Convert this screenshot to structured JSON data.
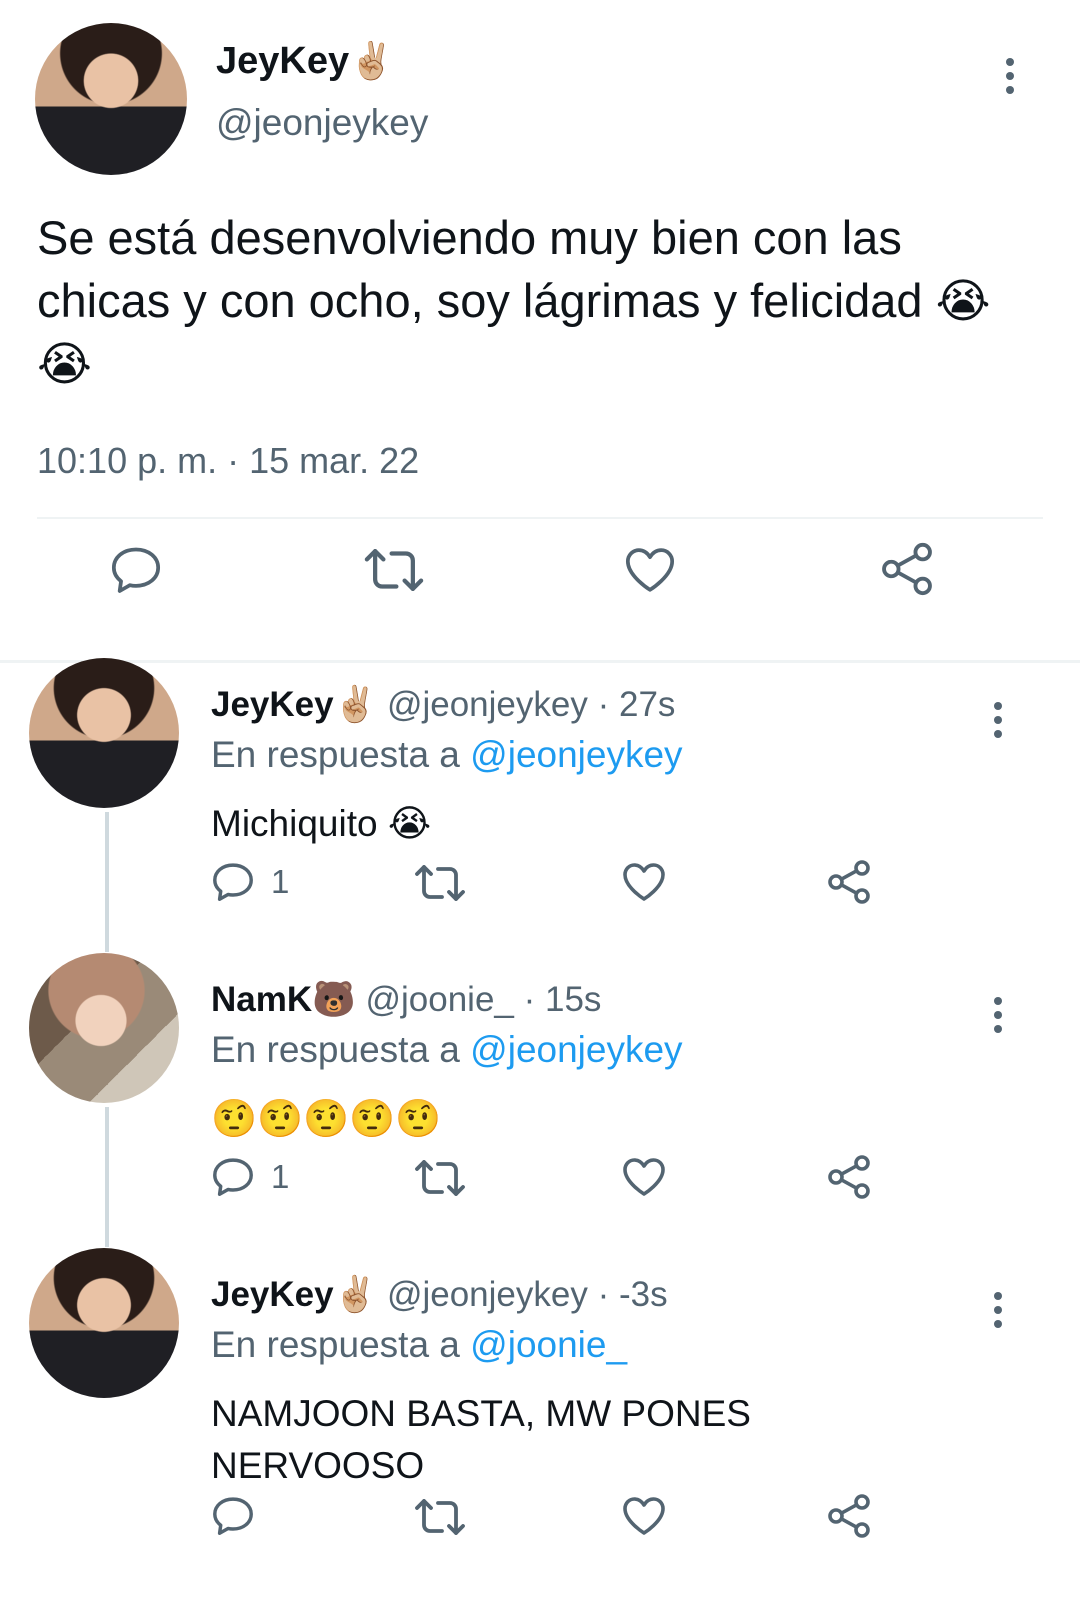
{
  "main_tweet": {
    "author_name": "JeyKey",
    "author_emoji": "✌🏼",
    "author_handle": "@jeonjeykey",
    "text": "Se está desenvolviendo muy bien con las chicas y con ocho, soy lágrimas y felicidad",
    "text_emoji": "😭😭",
    "timestamp": "10:10 p. m. · 15 mar. 22",
    "actions": [
      "reply-icon",
      "retweet-icon",
      "like-icon",
      "share-icon"
    ]
  },
  "replies": [
    {
      "author_name": "JeyKey",
      "author_emoji": "✌🏼",
      "author_handle": "@jeonjeykey",
      "time": "· 27s",
      "in_reply_prefix": "En respuesta a",
      "in_reply_to": "@jeonjeykey",
      "text": "Michiquito",
      "text_emoji": "😭",
      "reply_count": "1"
    },
    {
      "author_name": "NamK",
      "author_emoji": "🐻",
      "author_handle": "@joonie_",
      "time": "· 15s",
      "in_reply_prefix": "En respuesta a",
      "in_reply_to": "@jeonjeykey",
      "text": "",
      "text_emoji": "🤨🤨🤨🤨🤨",
      "reply_count": "1"
    },
    {
      "author_name": "JeyKey",
      "author_emoji": "✌🏼",
      "author_handle": "@jeonjeykey",
      "time": "· -3s",
      "in_reply_prefix": "En respuesta a",
      "in_reply_to": "@joonie_",
      "text": "NAMJOON BASTA, MW PONES NERVOOSO",
      "text_emoji": "",
      "reply_count": ""
    }
  ],
  "colors": {
    "text": "#0f1419",
    "secondary": "#536471",
    "link": "#1d9bf0",
    "divider": "#eff3f4",
    "thread_line": "#cfd9de"
  }
}
